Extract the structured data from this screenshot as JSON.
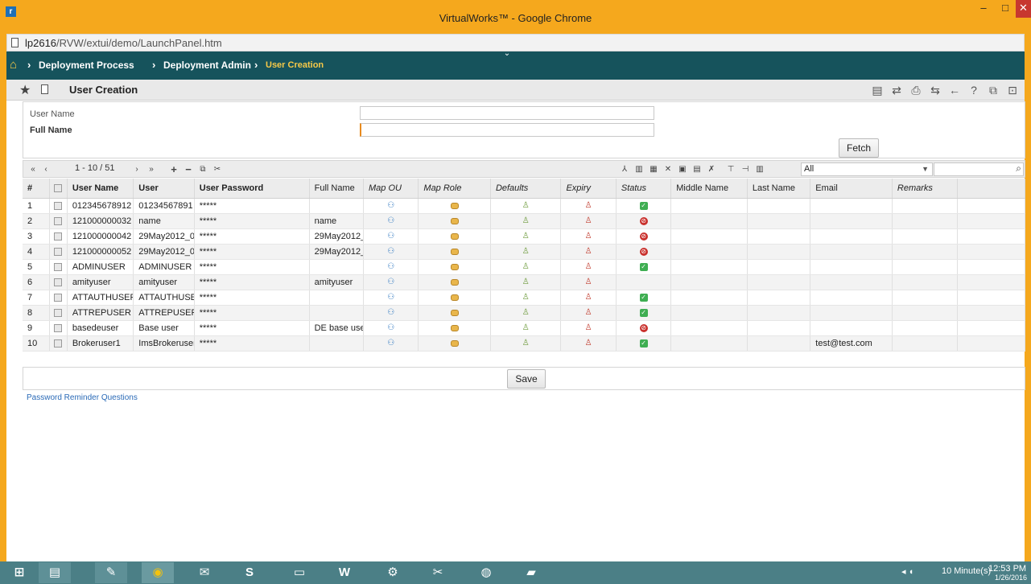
{
  "window": {
    "title": "VirtualWorks™ - Google Chrome",
    "min_label": "–",
    "max_label": "□",
    "close_label": "✕"
  },
  "address": {
    "host": "lp2616",
    "path": "/RVW/extui/demo/LaunchPanel.htm"
  },
  "breadcrumb": {
    "items": [
      "Deployment Process",
      "Deployment Admin",
      "User Creation"
    ],
    "separator": "›"
  },
  "page": {
    "title": "User Creation"
  },
  "form": {
    "user_name_label": "User Name",
    "full_name_label": "Full Name",
    "user_name_value": "",
    "full_name_value": "",
    "fetch_label": "Fetch"
  },
  "grid_toolbar": {
    "pager_text": "1 - 10 / 51",
    "filter_value": "All",
    "search_value": ""
  },
  "table": {
    "columns": [
      "#",
      "",
      "User Name",
      "User",
      "User Password",
      "Full Name",
      "Map OU",
      "Map Role",
      "Defaults",
      "Expiry",
      "Status",
      "Middle Name",
      "Last Name",
      "Email",
      "Remarks"
    ],
    "rows": [
      {
        "n": "1",
        "user_name": "012345678912",
        "user": "01234567891",
        "password": "*****",
        "full_name": "",
        "status": "ok",
        "email": ""
      },
      {
        "n": "2",
        "user_name": "121000000032",
        "user": "name",
        "password": "*****",
        "full_name": "name",
        "status": "no",
        "email": ""
      },
      {
        "n": "3",
        "user_name": "121000000042",
        "user": "29May2012_0",
        "password": "*****",
        "full_name": "29May2012_",
        "status": "no",
        "email": ""
      },
      {
        "n": "4",
        "user_name": "121000000052",
        "user": "29May2012_0",
        "password": "*****",
        "full_name": "29May2012_",
        "status": "no",
        "email": ""
      },
      {
        "n": "5",
        "user_name": "ADMINUSER",
        "user": "ADMINUSER",
        "password": "*****",
        "full_name": "",
        "status": "ok",
        "email": ""
      },
      {
        "n": "6",
        "user_name": "amityuser",
        "user": "amityuser",
        "password": "*****",
        "full_name": "amityuser",
        "status": "",
        "email": ""
      },
      {
        "n": "7",
        "user_name": "ATTAUTHUSER",
        "user": "ATTAUTHUSE",
        "password": "*****",
        "full_name": "",
        "status": "ok",
        "email": ""
      },
      {
        "n": "8",
        "user_name": "ATTREPUSER",
        "user": "ATTREPUSER",
        "password": "*****",
        "full_name": "",
        "status": "ok",
        "email": ""
      },
      {
        "n": "9",
        "user_name": "basedeuser",
        "user": "Base user",
        "password": "*****",
        "full_name": "DE base use",
        "status": "no",
        "email": ""
      },
      {
        "n": "10",
        "user_name": "Brokeruser1",
        "user": "ImsBrokeruser",
        "password": "*****",
        "full_name": "",
        "status": "ok",
        "email": "test@test.com"
      }
    ]
  },
  "save_label": "Save",
  "password_reminder_link": "Password Reminder Questions",
  "taskbar": {
    "time": "12:53 PM",
    "date": "1/26/2016",
    "timer_text": "10 Minute(s)"
  }
}
